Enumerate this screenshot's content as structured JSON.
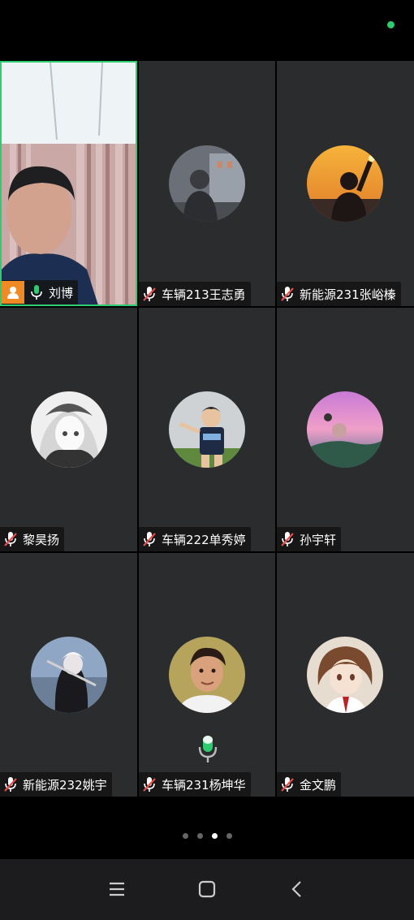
{
  "status": {
    "indicator_color": "#2ecc71"
  },
  "participants": [
    {
      "name": "刘博",
      "mic": "on",
      "host": true,
      "active": true
    },
    {
      "name": "车辆213王志勇",
      "mic": "muted"
    },
    {
      "name": "新能源231张峪榛",
      "mic": "muted"
    },
    {
      "name": "黎昊扬",
      "mic": "muted"
    },
    {
      "name": "车辆222单秀婷",
      "mic": "muted"
    },
    {
      "name": "孙宇轩",
      "mic": "muted"
    },
    {
      "name": "新能源232姚宇",
      "mic": "muted"
    },
    {
      "name": "车辆231杨坤华",
      "mic": "muted",
      "speaking": true
    },
    {
      "name": "金文鹏",
      "mic": "muted"
    }
  ],
  "pager": {
    "pages": 4,
    "current": 3
  },
  "navbar": {
    "icons": [
      "menu-icon",
      "home-icon",
      "back-icon"
    ]
  },
  "colors": {
    "accent": "#2ecc71",
    "host_badge": "#f08a24",
    "muted": "#e84d4d",
    "tile": "#2b2c2e"
  }
}
